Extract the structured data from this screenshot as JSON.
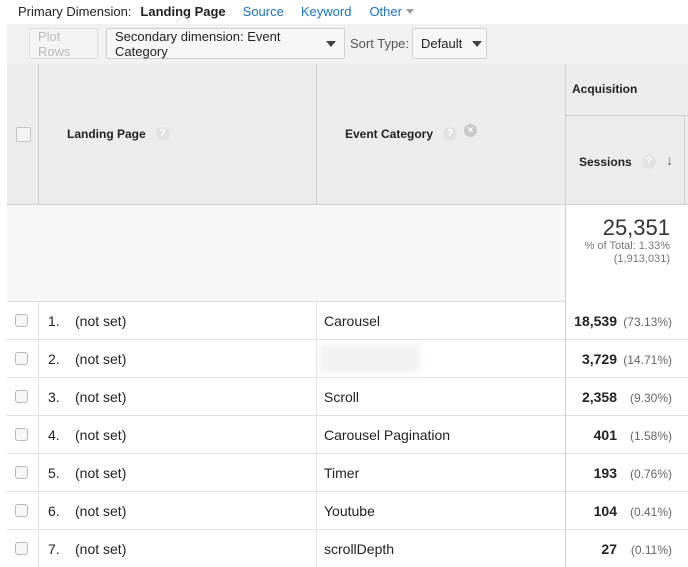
{
  "primary_dimension": {
    "label": "Primary Dimension:",
    "active": "Landing Page",
    "options": [
      "Source",
      "Keyword",
      "Other"
    ]
  },
  "toolbar": {
    "plot_rows": "Plot Rows",
    "secondary_dimension": "Secondary dimension: Event Category",
    "sort_type_label": "Sort Type:",
    "sort_type_value": "Default"
  },
  "table": {
    "headers": {
      "landing_page": "Landing Page",
      "event_category": "Event Category",
      "group": "Acquisition",
      "sessions": "Sessions",
      "help": "?",
      "remove": "×",
      "sort_arrow": "↓"
    },
    "totals": {
      "sessions": "25,351",
      "pct_line": "% of Total: 1.33%",
      "total_line": "(1,913,031)"
    },
    "rows": [
      {
        "num": "1.",
        "landing_page": "(not set)",
        "event_category": "Carousel",
        "sessions": "18,539",
        "pct": "(73.13%)"
      },
      {
        "num": "2.",
        "landing_page": "(not set)",
        "event_category": "",
        "sessions": "3,729",
        "pct": "(14.71%)"
      },
      {
        "num": "3.",
        "landing_page": "(not set)",
        "event_category": "Scroll",
        "sessions": "2,358",
        "pct": "(9.30%)"
      },
      {
        "num": "4.",
        "landing_page": "(not set)",
        "event_category": "Carousel Pagination",
        "sessions": "401",
        "pct": "(1.58%)"
      },
      {
        "num": "5.",
        "landing_page": "(not set)",
        "event_category": "Timer",
        "sessions": "193",
        "pct": "(0.76%)"
      },
      {
        "num": "6.",
        "landing_page": "(not set)",
        "event_category": "Youtube",
        "sessions": "104",
        "pct": "(0.41%)"
      },
      {
        "num": "7.",
        "landing_page": "(not set)",
        "event_category": "scrollDepth",
        "sessions": "27",
        "pct": "(0.11%)"
      }
    ]
  }
}
